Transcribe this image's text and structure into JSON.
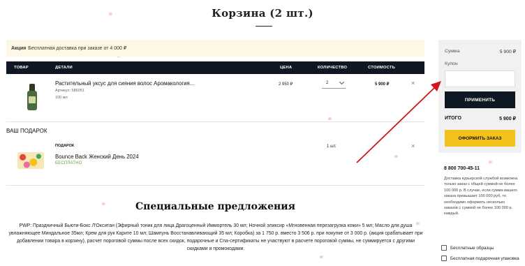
{
  "page": {
    "title": "Корзина (2 шт.)"
  },
  "promo": {
    "label": "Акция",
    "text": "Бесплатная доставка при заказе от 4 000 ₽"
  },
  "table": {
    "headers": {
      "product": "ТОВАР",
      "details": "ДЕТАЛИ",
      "price": "ЦЕНА",
      "quantity": "КОЛИЧЕСТВО",
      "cost": "СТОИМОСТЬ"
    }
  },
  "items": [
    {
      "name": "Растительный уксус для сияния волос Аромакология...",
      "article": "Артикул: 586051",
      "volume": "100 мл",
      "price": "2 950 ₽",
      "quantity": "2",
      "cost": "5 900 ₽"
    }
  ],
  "gift": {
    "section_label": "ВАШ ПОДАРОК",
    "tag": "ПОДАРОК",
    "name": "Bounce Back Женский День 2024",
    "status": "БЕСПЛАТНО",
    "quantity": "1 шт."
  },
  "offers": {
    "title": "Специальные предложения",
    "text": "PWP: Праздничный Бьюти-Бокс Л'Окситан (Эфирный тоник для лица Драгоценный Иммортель 30 мл; Ночной эликсир «Мгновенная перезагрузка кожи» 5 мл; Масло для душа увлажняющее Миндальное 35мл; Крем для рук Карите 10 мл; Шампунь Восстанавливающий 35 мл; Коробка) за 1 750 р. вместо 3 506 р. при покупке от 3 000 р. (акция срабатывает при добавлении товара в корзину), расчет пороговой суммы после всех скидок, подарочные и Спа-сертификаты не участвуют в расчете пороговой суммы, не суммируется с другими скидками и промокодами."
  },
  "summary": {
    "sum_label": "Сумма",
    "sum_value": "5 900 ₽",
    "coupon_label": "Купон",
    "coupon_placeholder": "",
    "apply_label": "ПРИМЕНИТЬ",
    "total_label": "ИТОГО",
    "total_value": "5 900 ₽",
    "order_label": "ОФОРМИТЬ ЗАКАЗ"
  },
  "contact": {
    "phone": "8 800 700-45-11",
    "delivery_text": "Доставка курьерской службой возможна только заказ с общей суммой не более 100 000 р. В случае, если сумма вашего заказа превышает 100 000 руб, то необходимо оформить несколько заказов с суммой не более 100 000 р. каждый."
  },
  "perks": [
    {
      "label": "Бесплатные образцы",
      "icon": "sample-icon"
    },
    {
      "label": "Бесплатная подарочная упаковка",
      "icon": "gift-box-icon"
    }
  ],
  "colors": {
    "dark": "#0f1722",
    "accent": "#f5c21b",
    "promo_bg": "#fdf7e3",
    "green": "#5aa638",
    "arrow": "#d0151b"
  }
}
